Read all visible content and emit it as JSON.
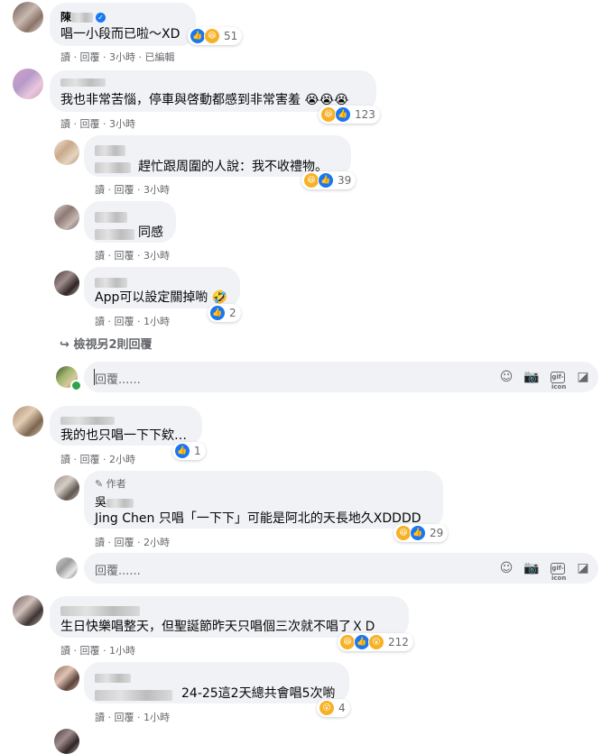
{
  "labels": {
    "read": "讀",
    "reply": "回覆",
    "dot": "·",
    "edited": "已編輯",
    "view_more": "檢視另2則回覆",
    "reply_placeholder": "回覆......",
    "author": "作者",
    "author_prefix": "吳"
  },
  "comments": [
    {
      "name": "陳",
      "text": "唱一小段而已啦～XD",
      "time": "3小時",
      "reaction_count": "51"
    },
    {
      "text": "我也非常苦惱，停車與啓動都感到非常害羞",
      "time": "3小時",
      "reaction_count": "123"
    },
    {
      "text": "趕忙跟周圍的人說：我不收禮物。",
      "time": "3小時",
      "reaction_count": "39"
    },
    {
      "text": "同感",
      "time": "3小時"
    },
    {
      "text": "App可以設定關掉喲",
      "time": "1小時",
      "reaction_count": "2"
    },
    {
      "text": "我的也只唱一下下欸…",
      "time": "2小時",
      "reaction_count": "1"
    },
    {
      "text": "Jing Chen 只唱「一下下」可能是阿北的天長地久XDDDD",
      "time": "2小時",
      "reaction_count": "29"
    },
    {
      "text": "生日快樂唱整天，但聖誕節昨天只唱個三次就不唱了ＸＤ",
      "time": "1小時",
      "reaction_count": "212"
    },
    {
      "text": "24-25這2天總共會唱5次喲",
      "time": "1小時",
      "reaction_count": "4"
    }
  ],
  "icons": {
    "like": "like-icon",
    "haha": "haha-icon",
    "wow": "wow-icon",
    "cry": "cry-icon",
    "emoji": "emoji-icon",
    "camera": "camera-icon",
    "gif": "gif-icon",
    "sticker": "sticker-icon"
  }
}
